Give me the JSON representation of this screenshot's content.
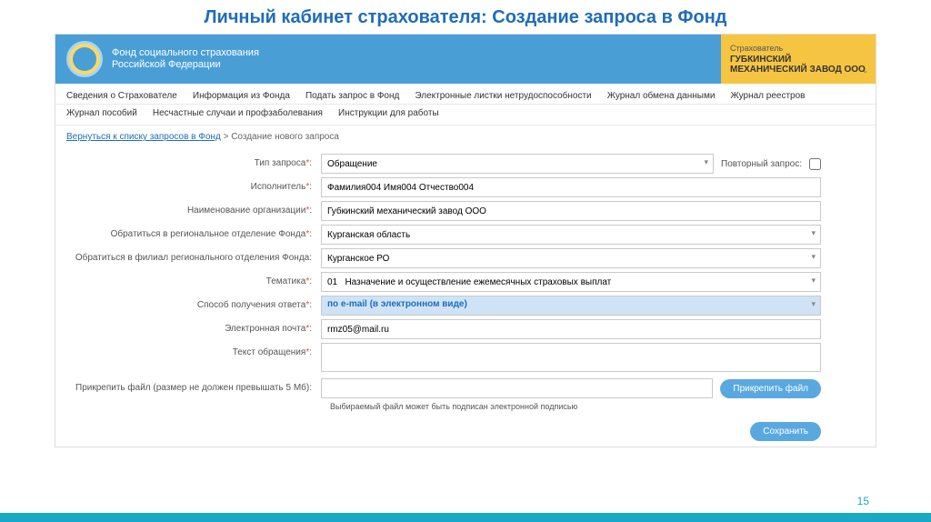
{
  "slideTitle": "Личный кабинет страхователя: Создание запроса в Фонд",
  "header": {
    "orgLine1": "Фонд социального страхования",
    "orgLine2": "Российской Федерации",
    "userLabel": "Страхователь",
    "userName": "ГУБКИНСКИЙ МЕХАНИЧЕСКИЙ ЗАВОД ООО"
  },
  "nav": {
    "row1": [
      "Сведения о Страхователе",
      "Информация из Фонда",
      "Подать запрос в Фонд",
      "Электронные листки нетрудоспособности",
      "Журнал обмена данными",
      "Журнал реестров"
    ],
    "row2": [
      "Журнал пособий",
      "Несчастные случаи и профзаболевания",
      "Инструкции для работы"
    ]
  },
  "breadcrumb": {
    "link": "Вернуться к списку запросов в Фонд",
    "current": "Создание нового запроса"
  },
  "form": {
    "typeLabel": "Тип запроса",
    "typeValue": "Обращение",
    "repeatLabel": "Повторный запрос:",
    "executorLabel": "Исполнитель",
    "executorValue": "Фамилия004 Имя004 Отчество004",
    "orgLabel": "Наименование организации",
    "orgValue": "Губкинский механический завод ООО",
    "regionLabel": "Обратиться в региональное отделение Фонда",
    "regionValue": "Курганская область",
    "branchLabel": "Обратиться в филиал регионального отделения Фонда:",
    "branchValue": "Курганское РО",
    "themeLabel": "Тематика",
    "themeValue": "01   Назначение и осуществление ежемесячных страховых выплат",
    "responseLabel": "Способ получения ответа",
    "responseValue": "по e-mail (в электронном виде)",
    "emailLabel": "Электронная почта",
    "emailValue": "rmz05@mail.ru",
    "textLabel": "Текст обращения",
    "textValue": "",
    "fileLabel": "Прикрепить файл (размер не должен превышать 5 Мб):",
    "fileButton": "Прикрепить файл",
    "fileNote": "Выбираемый файл может быть подписан электронной подписью",
    "saveButton": "Сохранить"
  },
  "pageNumber": "15"
}
